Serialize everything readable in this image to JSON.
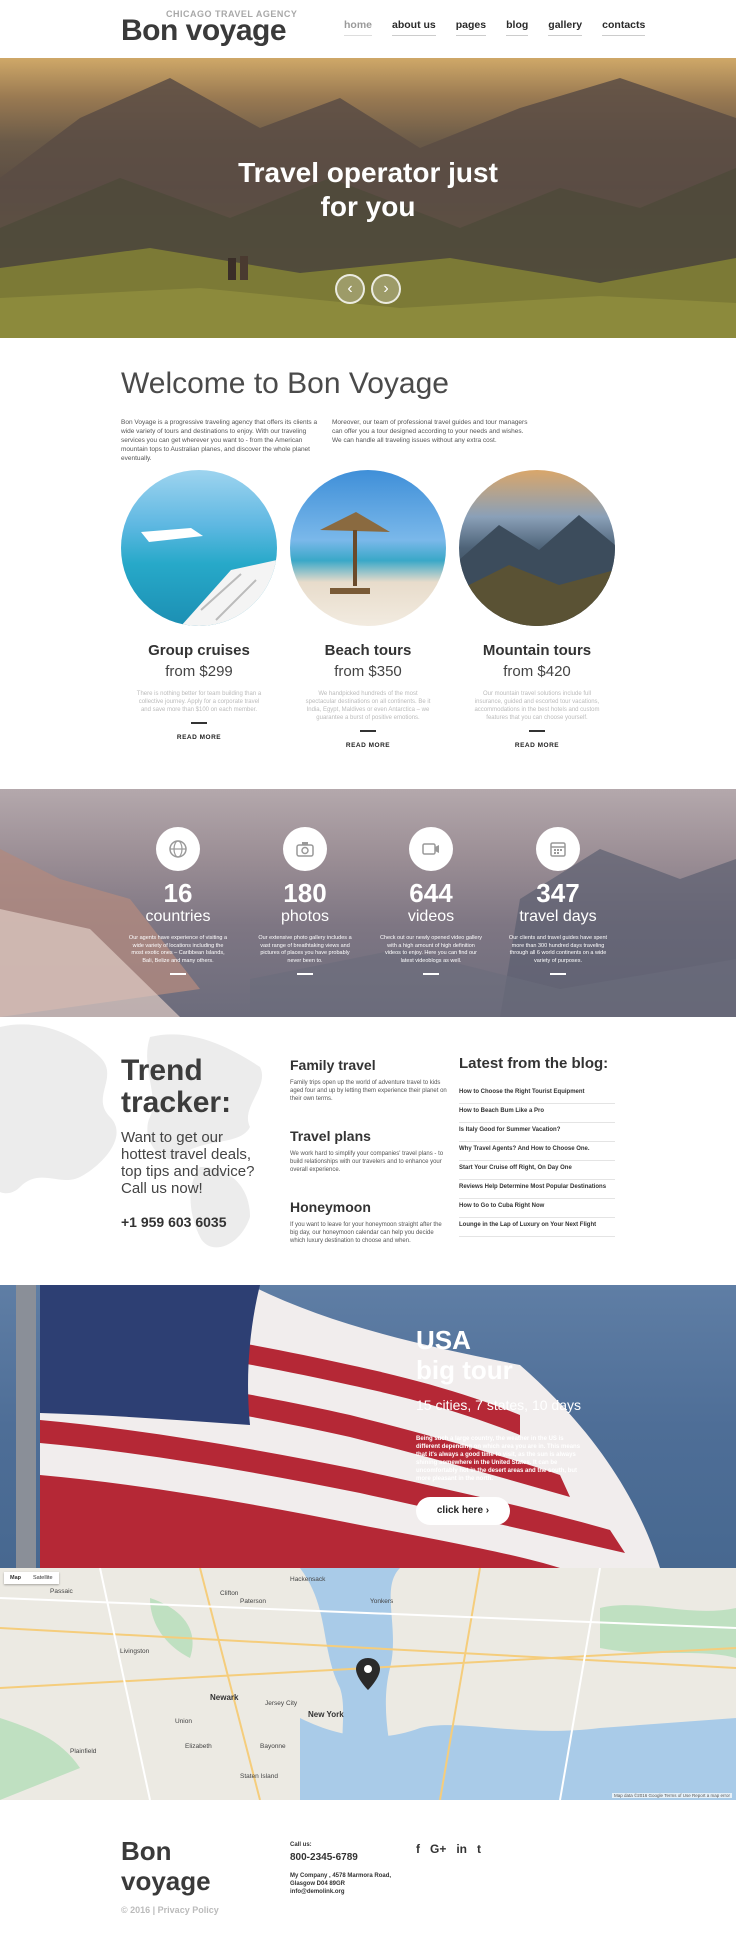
{
  "header": {
    "tagline": "CHICAGO TRAVEL AGENCY",
    "logo": "Bon voyage",
    "nav": [
      "home",
      "about us",
      "pages",
      "blog",
      "gallery",
      "contacts"
    ]
  },
  "hero": {
    "title_line1": "Travel operator just",
    "title_line2": "for you",
    "prev": "‹",
    "next": "›"
  },
  "welcome": {
    "title": "Welcome to Bon Voyage",
    "text_left": "Bon Voyage is a progressive traveling agency that offers its clients a wide variety of tours and destinations to enjoy. With our traveling services you can get wherever you want to - from the American mountain tops to Australian planes, and discover the whole planet eventually.",
    "text_right": "Moreover, our team of professional travel guides and tour managers can offer you a tour designed according to your needs and wishes. We can handle all traveling issues without any extra cost."
  },
  "tours": [
    {
      "name": "Group cruises",
      "price": "from $299",
      "desc": "There is nothing better for team building than a collective journey. Apply for a corporate travel and save more than $100 on each member.",
      "more": "READ MORE"
    },
    {
      "name": "Beach tours",
      "price": "from $350",
      "desc": "We handpicked hundreds of the most spectacular destinations on all continents. Be it India, Egypt, Maldives or even Antarctica – we guarantee a burst of positive emotions.",
      "more": "READ MORE"
    },
    {
      "name": "Mountain tours",
      "price": "from $420",
      "desc": "Our mountain travel solutions include full insurance, guided and escorted tour vacations, accommodations in the best hotels and custom features that you can choose yourself.",
      "more": "READ MORE"
    }
  ],
  "stats": [
    {
      "icon": "globe-icon",
      "num": "16",
      "label": "countries",
      "desc": "Our agents have experience of visiting a wide variety of locations including the most exotic ones – Caribbean Islands, Bali, Belize and many others."
    },
    {
      "icon": "camera-icon",
      "num": "180",
      "label": "photos",
      "desc": "Our extensive photo gallery includes a vast range of breathtaking views and pictures of places you have probably never been to."
    },
    {
      "icon": "video-icon",
      "num": "644",
      "label": "videos",
      "desc": "Check out our newly opened video gallery with a high amount of high definition videos to enjoy. Here you can find our latest videoblogs as well."
    },
    {
      "icon": "calendar-icon",
      "num": "347",
      "label": "travel days",
      "desc": "Our clients and travel guides have spent more than 300 hundred days traveling through all 6 world continents on a wide variety of purposes."
    }
  ],
  "trend": {
    "title_line1": "Trend",
    "title_line2": "tracker:",
    "subtitle": "Want to get our hottest travel deals, top tips and advice? Call us now!",
    "phone": "+1 959 603 6035",
    "services": [
      {
        "title": "Family travel",
        "desc": "Family trips open up the world of adventure travel to kids aged four and up by letting them experience their planet on their own terms."
      },
      {
        "title": "Travel plans",
        "desc": "We work hard to simplify your companies' travel plans - to build relationships with our travelers and to enhance your overall experience."
      },
      {
        "title": "Honeymoon",
        "desc": "If you want to leave for your honeymoon straight after the big day, our honeymoon calendar can help you decide which luxury destination to choose and when."
      }
    ],
    "blog_title": "Latest from the blog:",
    "blog": [
      "How to Choose the Right Tourist Equipment",
      "How to Beach Bum Like a Pro",
      "Is Italy Good for Summer Vacation?",
      "Why Travel Agents? And How to Choose One.",
      "Start Your Cruise off Right, On Day One",
      "Reviews Help Determine Most Popular Destinations",
      "How to Go to Cuba Right Now",
      "Lounge in the Lap of Luxury on Your Next Flight"
    ]
  },
  "usa": {
    "title_line1": "USA",
    "title_line2": "big tour",
    "subtitle": "15 cities, 7 states, 10 days",
    "desc": "Being such a large country, the weather in the US is different depending on which area you are in. This means that it's always a good time to visit, as the sun is always shining somewhere in the United States. It can be uncomfortably hot in the desert areas and the south, but more pleasant in the north.",
    "button": "click here ›"
  },
  "map": {
    "tab_map": "Map",
    "tab_satellite": "Satellite",
    "labels": [
      "Passaic",
      "Clifton",
      "Paterson",
      "Hackensack",
      "Newark",
      "Jersey City",
      "New York",
      "Elizabeth",
      "Staten Island",
      "Bayonne",
      "Yonkers",
      "Plainfield",
      "Livingston",
      "Union"
    ],
    "credit": "Map data ©2016 Google   Terms of Use   Report a map error"
  },
  "footer": {
    "brand_line1": "Bon",
    "brand_line2": "voyage",
    "copyright": "© 2016 | Privacy Policy",
    "call_label": "Call us:",
    "phone": "800-2345-6789",
    "address": "My Company , 4578 Marmora Road, Glasgow D04 89GR",
    "email": "info@demolink.org",
    "social": [
      "f",
      "G+",
      "in",
      "t"
    ]
  }
}
